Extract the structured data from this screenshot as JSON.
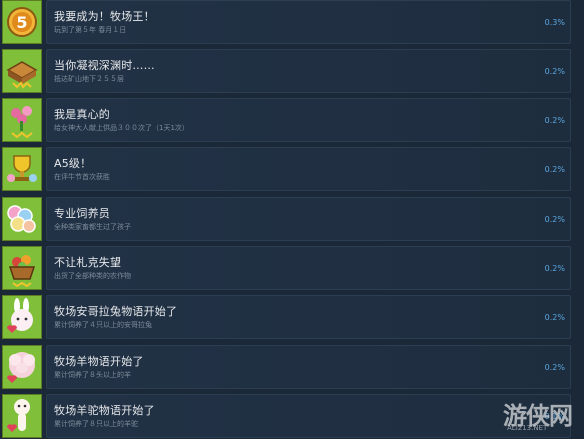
{
  "achievements": [
    {
      "title": "我要成为！牧场王！",
      "desc": "玩到了第５年 春月１日",
      "pct": "0.3%",
      "icon": "medal-five-icon"
    },
    {
      "title": "当你凝视深渊时……",
      "desc": "抵达矿山地下２５５层",
      "pct": "0.2%",
      "icon": "mine-crate-icon"
    },
    {
      "title": "我是真心的",
      "desc": "给女神大人献上供品３００次了（1天1次）",
      "pct": "0.2%",
      "icon": "flower-offering-icon"
    },
    {
      "title": "A5级！",
      "desc": "在评牛节首次获胜",
      "pct": "0.2%",
      "icon": "trophy-cup-icon"
    },
    {
      "title": "专业饲养员",
      "desc": "全种类家畜都生过了孩子",
      "pct": "0.2%",
      "icon": "livestock-eggs-icon"
    },
    {
      "title": "不让札克失望",
      "desc": "出货了全部种类的农作物",
      "pct": "0.2%",
      "icon": "crop-basket-icon"
    },
    {
      "title": "牧场安哥拉兔物语开始了",
      "desc": "累计饲养了４只以上的安哥拉兔",
      "pct": "0.2%",
      "icon": "angora-rabbit-icon"
    },
    {
      "title": "牧场羊物语开始了",
      "desc": "累计饲养了８头以上的羊",
      "pct": "0.2%",
      "icon": "sheep-icon"
    },
    {
      "title": "牧场羊驼物语开始了",
      "desc": "累计饲养了８只以上的羊驼",
      "pct": "0.1%",
      "icon": "alpaca-icon"
    }
  ],
  "watermark": {
    "text": "游侠网",
    "sub": "ALI213.NET"
  },
  "colors": {
    "background": "#1b2838",
    "panel": "#223246",
    "title": "#e6e8ea",
    "desc": "#7e8c9b",
    "percent": "#5aa6de",
    "icon_bg": "#7fbf3a"
  }
}
